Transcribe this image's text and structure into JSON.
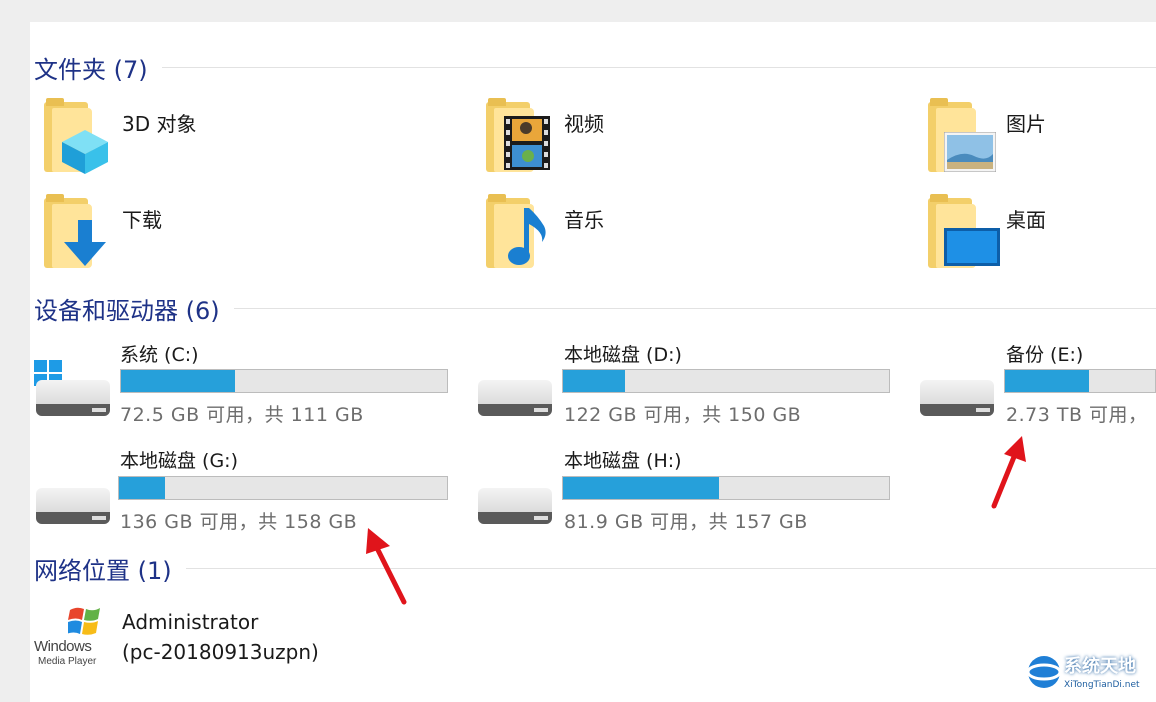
{
  "groups": {
    "folders": {
      "title": "文件夹 (7)"
    },
    "drives": {
      "title": "设备和驱动器 (6)"
    },
    "network": {
      "title": "网络位置 (1)"
    }
  },
  "folders": [
    {
      "label": "3D 对象",
      "icon": "3d-objects-icon"
    },
    {
      "label": "视频",
      "icon": "video-folder-icon"
    },
    {
      "label": "图片",
      "icon": "pictures-folder-icon"
    },
    {
      "label": "下载",
      "icon": "downloads-folder-icon"
    },
    {
      "label": "音乐",
      "icon": "music-folder-icon"
    },
    {
      "label": "桌面",
      "icon": "desktop-folder-icon"
    }
  ],
  "drives": [
    {
      "name": "系统 (C:)",
      "free_text": "72.5 GB 可用，共 111 GB",
      "used_fraction": 0.35
    },
    {
      "name": "本地磁盘 (D:)",
      "free_text": "122 GB 可用，共 150 GB",
      "used_fraction": 0.19
    },
    {
      "name": "备份 (E:)",
      "free_text": "2.73 TB 可用，",
      "used_fraction": 0.56
    },
    {
      "name": "本地磁盘 (G:)",
      "free_text": "136 GB 可用，共 158 GB",
      "used_fraction": 0.14
    },
    {
      "name": "本地磁盘 (H:)",
      "free_text": "81.9 GB 可用，共 157 GB",
      "used_fraction": 0.48
    }
  ],
  "network": [
    {
      "name": "Administrator",
      "detail": "(pc-20180913uzpn)",
      "icon_text_1": "Windows",
      "icon_text_2": "Media Player"
    }
  ],
  "watermark": {
    "text": "系统天地",
    "sub": "XiTongTianDi.net"
  },
  "colors": {
    "group_title": "#1e3287",
    "bar_fill": "#26a0da",
    "arrow": "#e0141b"
  }
}
